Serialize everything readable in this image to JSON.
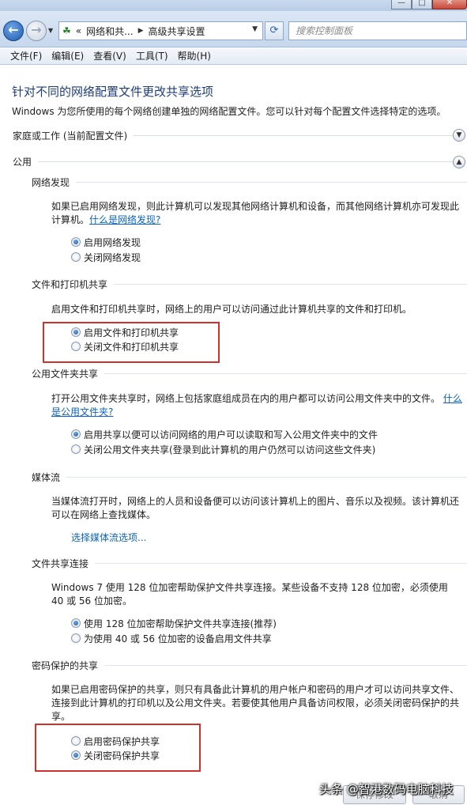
{
  "window": {
    "minimize": "—",
    "maximize": "□",
    "close": "✕"
  },
  "address": {
    "crumb1": "网络和共...",
    "crumb2": "高级共享设置",
    "prefix": "«",
    "search_placeholder": "搜索控制面板"
  },
  "menu": [
    "文件(F)",
    "编辑(E)",
    "查看(V)",
    "工具(T)",
    "帮助(H)"
  ],
  "page": {
    "title": "针对不同的网络配置文件更改共享选项",
    "description": "Windows 为您所使用的每个网络创建单独的网络配置文件。您可以针对每个配置文件选择特定的选项。"
  },
  "profiles": {
    "home": "家庭或工作 (当前配置文件)",
    "public": "公用"
  },
  "network_discovery": {
    "heading": "网络发现",
    "text": "如果已启用网络发现，则此计算机可以发现其他网络计算机和设备，而其他网络计算机亦可发现此计算机。",
    "link": "什么是网络发现?",
    "options": [
      "启用网络发现",
      "关闭网络发现"
    ],
    "selected": 0
  },
  "file_printer": {
    "heading": "文件和打印机共享",
    "text": "启用文件和打印机共享时，网络上的用户可以访问通过此计算机共享的文件和打印机。",
    "options": [
      "启用文件和打印机共享",
      "关闭文件和打印机共享"
    ],
    "selected": 0
  },
  "public_folder": {
    "heading": "公用文件夹共享",
    "text": "打开公用文件夹共享时，网络上包括家庭组成员在内的用户都可以访问公用文件夹中的文件。",
    "link": "什么是公用文件夹?",
    "options": [
      "启用共享以便可以访问网络的用户可以读取和写入公用文件夹中的文件",
      "关闭公用文件夹共享(登录到此计算机的用户仍然可以访问这些文件夹)"
    ],
    "selected": 0
  },
  "media": {
    "heading": "媒体流",
    "text": "当媒体流打开时，网络上的人员和设备便可以访问该计算机上的图片、音乐以及视频。该计算机还可以在网络上查找媒体。",
    "link": "选择媒体流选项..."
  },
  "file_sharing": {
    "heading": "文件共享连接",
    "text": "Windows 7 使用 128 位加密帮助保护文件共享连接。某些设备不支持 128 位加密，必须使用 40 或 56 位加密。",
    "options": [
      "使用 128 位加密帮助保护文件共享连接(推荐)",
      "为使用 40 或 56 位加密的设备启用文件共享"
    ],
    "selected": 0
  },
  "password": {
    "heading": "密码保护的共享",
    "text": "如果已启用密码保护的共享，则只有具备此计算机的用户帐户和密码的用户才可以访问共享文件、连接到此计算机的打印机以及公用文件夹。若要使其他用户具备访问权限，必须关闭密码保护的共享。",
    "options": [
      "启用密码保护共享",
      "关闭密码保护共享"
    ],
    "selected": 1
  },
  "buttons": {
    "save": "保存修改",
    "cancel": "取消"
  },
  "watermark": "头条 @智港数码电脑科技",
  "colors": {
    "highlight": "#d0312d",
    "link": "#0d63c3",
    "title": "#1e3d7a"
  }
}
